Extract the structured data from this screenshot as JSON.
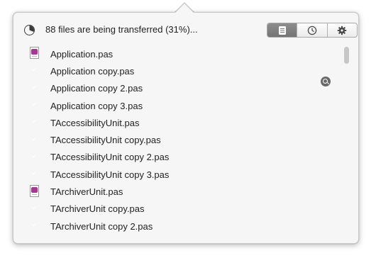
{
  "header": {
    "status_text": "88 files are being transferred (31%)...",
    "progress_percent": 31,
    "progress_icon": "pie-progress-icon",
    "segmented": [
      {
        "name": "transfers",
        "icon": "file-list-icon",
        "active": true
      },
      {
        "name": "history",
        "icon": "clock-icon",
        "active": false
      },
      {
        "name": "settings",
        "icon": "gear-icon",
        "active": false
      }
    ]
  },
  "files": [
    {
      "name": "Application.pas",
      "status": "in-progress"
    },
    {
      "name": "Application copy.pas",
      "status": "done"
    },
    {
      "name": "Application copy 2.pas",
      "status": "done"
    },
    {
      "name": "Application copy 3.pas",
      "status": "done"
    },
    {
      "name": "TAccessibilityUnit.pas",
      "status": "done"
    },
    {
      "name": "TAccessibilityUnit copy.pas",
      "status": "done"
    },
    {
      "name": "TAccessibilityUnit copy 2.pas",
      "status": "done"
    },
    {
      "name": "TAccessibilityUnit copy 3.pas",
      "status": "done"
    },
    {
      "name": "TArchiverUnit.pas",
      "status": "in-progress"
    },
    {
      "name": "TArchiverUnit copy.pas",
      "status": "done"
    },
    {
      "name": "TArchiverUnit copy 2.pas",
      "status": "done"
    }
  ],
  "row_action_icon": "reveal-magnifier-icon",
  "colors": {
    "popover_bg": "#f6f6f6",
    "check_gray": "#6f6f6f",
    "doc_accent": "#a23a8e",
    "segment_active": "#7e7e7e"
  }
}
